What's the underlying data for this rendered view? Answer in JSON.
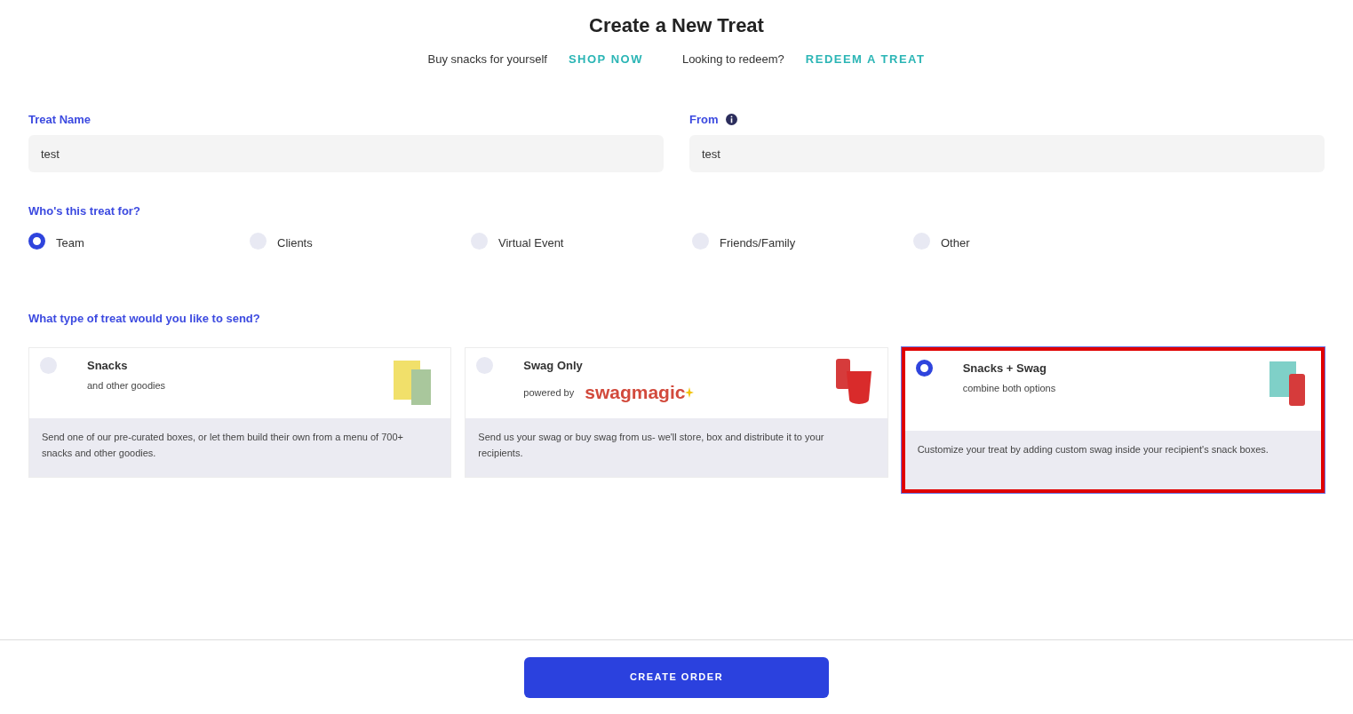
{
  "title": "Create a New Treat",
  "links": [
    {
      "prompt": "Buy snacks for yourself",
      "link": "SHOP NOW"
    },
    {
      "prompt": "Looking to redeem?",
      "link": "REDEEM A TREAT"
    }
  ],
  "fields": [
    {
      "label": "Treat Name",
      "value": "test",
      "info": false
    },
    {
      "label": "From",
      "value": "test",
      "info": true
    }
  ],
  "recipient": {
    "label": "Who's this treat for?",
    "options": [
      {
        "label": "Team",
        "selected": true
      },
      {
        "label": "Clients",
        "selected": false
      },
      {
        "label": "Virtual Event",
        "selected": false
      },
      {
        "label": "Friends/Family",
        "selected": false
      },
      {
        "label": "Other",
        "selected": false
      }
    ]
  },
  "treat_type": {
    "label": "What type of treat would you like to send?",
    "options": [
      {
        "kind": "snacks",
        "title": "Snacks",
        "subtitle": "and other goodies",
        "description": "Send one of our pre-curated boxes, or let them build their own from a menu of 700+ snacks and other goodies.",
        "selected": false,
        "highlighted": false
      },
      {
        "kind": "swag",
        "title": "Swag Only",
        "powered_by": "powered by",
        "logo": "swagmagic",
        "description": "Send us your swag or buy swag from us- we'll store, box and distribute it to your recipients.",
        "selected": false,
        "highlighted": false
      },
      {
        "kind": "combo",
        "title": "Snacks + Swag",
        "subtitle": "combine both options",
        "description": "Customize your treat by adding custom swag inside your recipient's snack boxes.",
        "selected": true,
        "highlighted": true
      }
    ]
  },
  "submit": "CREATE ORDER"
}
